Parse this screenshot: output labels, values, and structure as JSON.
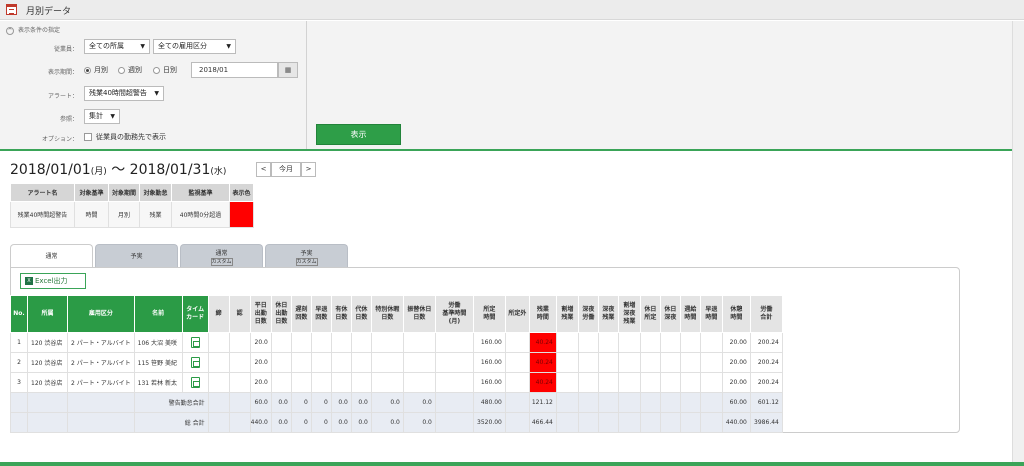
{
  "window": {
    "title": "月別データ"
  },
  "conditions": {
    "header": "表示条件の指定",
    "employee_label": "従業員：",
    "employee_select1": "全ての所属",
    "employee_select2": "全ての雇用区分",
    "period_label": "表示期間：",
    "period_options": [
      "月別",
      "週別",
      "日別"
    ],
    "period_selected": "月別",
    "date_value": "2018/01",
    "alert_label": "アラート：",
    "alert_value": "残業40時間超警告",
    "reference_label": "参照：",
    "reference_value": "集計",
    "option_label": "オプション：",
    "option_text": "従業員の勤務先で表示",
    "show_button": "表示"
  },
  "range": {
    "start": "2018/01/01",
    "start_dow": "月",
    "sep": "〜",
    "end": "2018/01/31",
    "end_dow": "水",
    "prev": "<",
    "this_month": "今月",
    "next": ">"
  },
  "alert_table": {
    "headers": [
      "アラート名",
      "対象基準",
      "対象期間",
      "対象勤怠",
      "監視基準",
      "表示色"
    ],
    "row": [
      "残業40時間超警告",
      "時間",
      "月別",
      "残業",
      "40時間0分超過"
    ],
    "color": "#ff0000"
  },
  "tabs": [
    {
      "label": "通常",
      "sub": ""
    },
    {
      "label": "予実",
      "sub": ""
    },
    {
      "label": "通常",
      "sub": "カスタム"
    },
    {
      "label": "予実",
      "sub": "カスタム"
    }
  ],
  "excel_button": "Excel出力",
  "grid": {
    "headers": [
      "No.",
      "所属",
      "雇用区分",
      "名前",
      "タイム\nカード",
      "締",
      "認",
      "平日\n出勤\n日数",
      "休日\n出勤\n日数",
      "遅刻\n回数",
      "早退\n回数",
      "有休\n日数",
      "代休\n日数",
      "特別休暇\n日数",
      "振替休日\n日数",
      "労働\n基準時間\n(月)",
      "所定\n時間",
      "所定外",
      "残業\n時間",
      "割増\n残業",
      "深夜\n労働",
      "深夜\n残業",
      "割増\n深夜\n残業",
      "休日\n所定",
      "休日\n深夜",
      "週給\n時間",
      "早退\n時間",
      "休憩\n時間",
      "労働\n合計"
    ],
    "rows": [
      [
        "1",
        "120 渋谷店",
        "2 パート・アルバイト",
        "106 大沼 美咲",
        "",
        "",
        "",
        "20.0",
        "",
        "",
        "",
        "",
        "",
        "",
        "",
        "",
        "160.00",
        "",
        "40.24",
        "",
        "",
        "",
        "",
        "",
        "",
        "",
        "",
        "20.00",
        "200.24"
      ],
      [
        "2",
        "120 渋谷店",
        "2 パート・アルバイト",
        "115 笹野 美紀",
        "",
        "",
        "",
        "20.0",
        "",
        "",
        "",
        "",
        "",
        "",
        "",
        "",
        "160.00",
        "",
        "40.24",
        "",
        "",
        "",
        "",
        "",
        "",
        "",
        "",
        "20.00",
        "200.24"
      ],
      [
        "3",
        "120 渋谷店",
        "2 パート・アルバイト",
        "131 若林 新太",
        "",
        "",
        "",
        "20.0",
        "",
        "",
        "",
        "",
        "",
        "",
        "",
        "",
        "160.00",
        "",
        "40.24",
        "",
        "",
        "",
        "",
        "",
        "",
        "",
        "",
        "20.00",
        "200.24"
      ]
    ],
    "sum1_label": "警告勤怠合計",
    "sum1": [
      "60.0",
      "0.0",
      "0",
      "0",
      "0.0",
      "0.0",
      "0.0",
      "0.0",
      "",
      "480.00",
      "",
      "121.12",
      "",
      "",
      "",
      "",
      "",
      "",
      "",
      "",
      "60.00",
      "601.12"
    ],
    "sum2_label": "総 合計",
    "sum2": [
      "440.0",
      "0.0",
      "0",
      "0",
      "0.0",
      "0.0",
      "0.0",
      "0.0",
      "",
      "3520.00",
      "",
      "466.44",
      "",
      "",
      "",
      "",
      "",
      "",
      "",
      "",
      "440.00",
      "3986.44"
    ],
    "alert_color": "#ff0000"
  }
}
